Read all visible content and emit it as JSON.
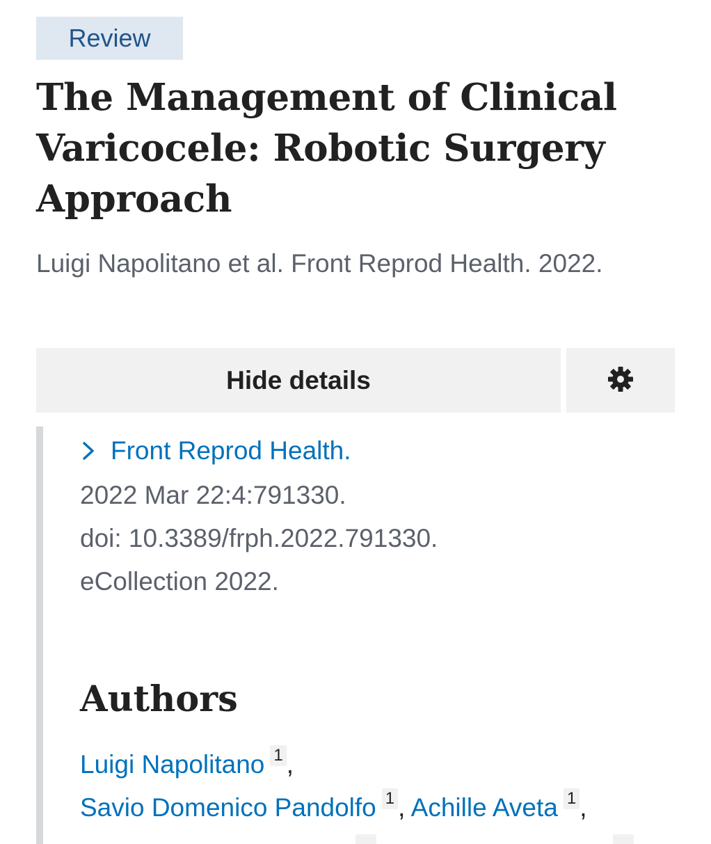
{
  "article": {
    "type_badge": "Review",
    "title": "The Management of Clinical Varicocele: Robotic Surgery Approach",
    "citation": "Luigi Napolitano et al. Front Reprod Health. 2022."
  },
  "controls": {
    "hide_details_label": "Hide details",
    "settings_icon": "gear-icon"
  },
  "details": {
    "journal_link": "Front Reprod Health.",
    "date_line": "2022 Mar 22:4:791330.",
    "doi_line": "doi: 10.3389/frph.2022.791330.",
    "collection_line": "eCollection 2022."
  },
  "authors": {
    "heading": "Authors",
    "list": [
      {
        "name": "Luigi Napolitano",
        "affiliation": "1"
      },
      {
        "name": "Savio Domenico Pandolfo",
        "affiliation": "1"
      },
      {
        "name": "Achille Aveta",
        "affiliation": "1"
      }
    ]
  },
  "colors": {
    "link": "#0071bc",
    "badge_bg": "#dfe7f1",
    "badge_text": "#20558a",
    "button_bg": "#f1f1f1",
    "muted_text": "#5b616b",
    "heading_text": "#212121"
  }
}
